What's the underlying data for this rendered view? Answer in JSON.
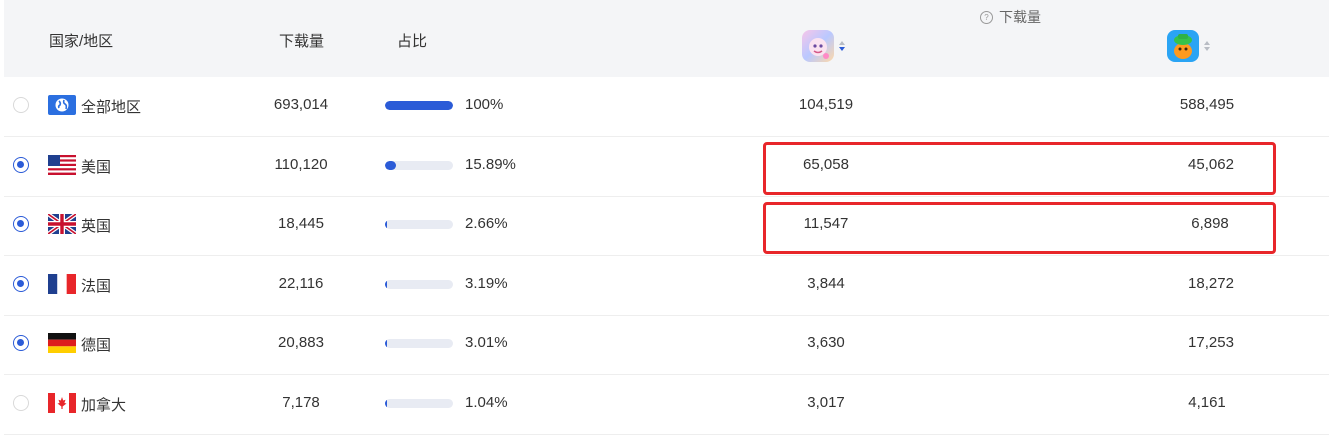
{
  "header": {
    "country_col": "国家/地区",
    "downloads_col": "下载量",
    "share_col": "占比",
    "group_title": "下载量",
    "help_icon": "help-circle-icon",
    "apps": [
      {
        "name": "app-1",
        "icon": "app-1-icon"
      },
      {
        "name": "app-2",
        "icon": "app-2-icon"
      }
    ]
  },
  "rows": [
    {
      "country": "全部地区",
      "flag": "globe",
      "downloads": "693,014",
      "share": 1.0,
      "share_text": "100%",
      "app1": "104,519",
      "app2": "588,495",
      "selected": false
    },
    {
      "country": "美国",
      "flag": "us",
      "downloads": "110,120",
      "share": 0.1589,
      "share_text": "15.89%",
      "app1": "65,058",
      "app2": "45,062",
      "selected": true
    },
    {
      "country": "英国",
      "flag": "uk",
      "downloads": "18,445",
      "share": 0.0266,
      "share_text": "2.66%",
      "app1": "11,547",
      "app2": "6,898",
      "selected": true
    },
    {
      "country": "法国",
      "flag": "fr",
      "downloads": "22,116",
      "share": 0.0319,
      "share_text": "3.19%",
      "app1": "3,844",
      "app2": "18,272",
      "selected": true
    },
    {
      "country": "德国",
      "flag": "de",
      "downloads": "20,883",
      "share": 0.0301,
      "share_text": "3.01%",
      "app1": "3,630",
      "app2": "17,253",
      "selected": true
    },
    {
      "country": "加拿大",
      "flag": "ca",
      "downloads": "7,178",
      "share": 0.0104,
      "share_text": "1.04%",
      "app1": "3,017",
      "app2": "4,161",
      "selected": false
    }
  ],
  "colors": {
    "accent": "#2b5bd7",
    "highlight": "#e8262a",
    "header_bg": "#f4f5f7"
  }
}
